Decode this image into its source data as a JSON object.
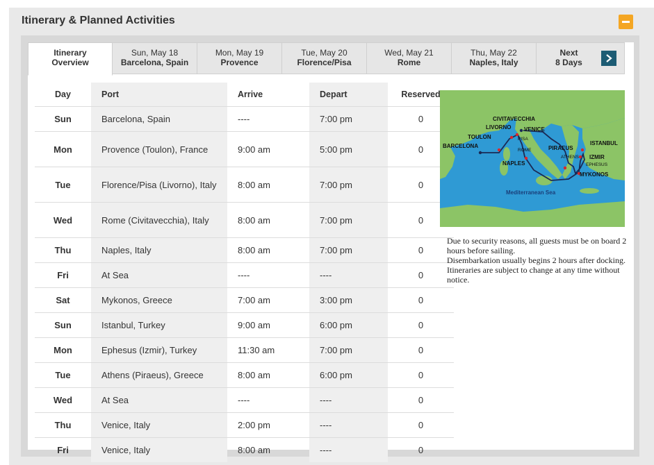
{
  "section_title": "Itinerary & Planned Activities",
  "tabs": [
    {
      "line1": "Itinerary",
      "line2": "Overview"
    },
    {
      "line1": "Sun, May 18",
      "line2": "Barcelona, Spain"
    },
    {
      "line1": "Mon, May 19",
      "line2": "Provence"
    },
    {
      "line1": "Tue, May 20",
      "line2": "Florence/Pisa"
    },
    {
      "line1": "Wed, May 21",
      "line2": "Rome"
    },
    {
      "line1": "Thu, May 22",
      "line2": "Naples, Italy"
    },
    {
      "line1": "Next",
      "line2": "8 Days"
    }
  ],
  "table": {
    "headers": {
      "day": "Day",
      "port": "Port",
      "arrive": "Arrive",
      "depart": "Depart",
      "reserved": "Reserved"
    },
    "rows": [
      {
        "day": "Sun",
        "port": "Barcelona, Spain",
        "arrive": "----",
        "depart": "7:00 pm",
        "reserved": "0"
      },
      {
        "day": "Mon",
        "port": "Provence (Toulon), France",
        "arrive": "9:00 am",
        "depart": "5:00 pm",
        "reserved": "0"
      },
      {
        "day": "Tue",
        "port": "Florence/Pisa (Livorno), Italy",
        "arrive": "8:00 am",
        "depart": "7:00 pm",
        "reserved": "0"
      },
      {
        "day": "Wed",
        "port": "Rome (Civitavecchia), Italy",
        "arrive": "8:00 am",
        "depart": "7:00 pm",
        "reserved": "0"
      },
      {
        "day": "Thu",
        "port": "Naples, Italy",
        "arrive": "8:00 am",
        "depart": "7:00 pm",
        "reserved": "0"
      },
      {
        "day": "Fri",
        "port": "At Sea",
        "arrive": "----",
        "depart": "----",
        "reserved": "0"
      },
      {
        "day": "Sat",
        "port": "Mykonos, Greece",
        "arrive": "7:00 am",
        "depart": "3:00 pm",
        "reserved": "0"
      },
      {
        "day": "Sun",
        "port": "Istanbul, Turkey",
        "arrive": "9:00 am",
        "depart": "6:00 pm",
        "reserved": "0"
      },
      {
        "day": "Mon",
        "port": "Ephesus (Izmir), Turkey",
        "arrive": "11:30 am",
        "depart": "7:00 pm",
        "reserved": "0"
      },
      {
        "day": "Tue",
        "port": "Athens (Piraeus), Greece",
        "arrive": "8:00 am",
        "depart": "6:00 pm",
        "reserved": "0"
      },
      {
        "day": "Wed",
        "port": "At Sea",
        "arrive": "----",
        "depart": "----",
        "reserved": "0"
      },
      {
        "day": "Thu",
        "port": "Venice, Italy",
        "arrive": "2:00 pm",
        "depart": "----",
        "reserved": "0"
      },
      {
        "day": "Fri",
        "port": "Venice, Italy",
        "arrive": "8:00 am",
        "depart": "----",
        "reserved": "0"
      }
    ]
  },
  "map": {
    "labels": {
      "civitavecchia": "CIVITAVECCHIA",
      "livorno": "LIVORNO",
      "venice": "VENICE",
      "toulon": "TOULON",
      "pisa": "PISA",
      "rome": "ROME",
      "barcelona": "BARCELONA",
      "piraeus": "PIRAEUS",
      "istanbul": "ISTANBUL",
      "athens": "ATHENS",
      "izmir": "IZMIR",
      "ephesus": "EPHESUS",
      "naples": "NAPLES",
      "mykonos": "MYKONOS",
      "sea": "Mediterranean Sea"
    },
    "colors": {
      "land": "#8cc466",
      "sea": "#2f9ad4",
      "route": "#1a2a55",
      "port": "#d8262c"
    }
  },
  "notes": [
    "Due to security reasons, all guests must be on board 2 hours before sailing.",
    "Disembarkation usually begins 2 hours after docking.",
    "Itineraries are subject to change at any time without notice."
  ],
  "colors": {
    "accent": "#1d5c74",
    "collapse": "#f4a623"
  }
}
